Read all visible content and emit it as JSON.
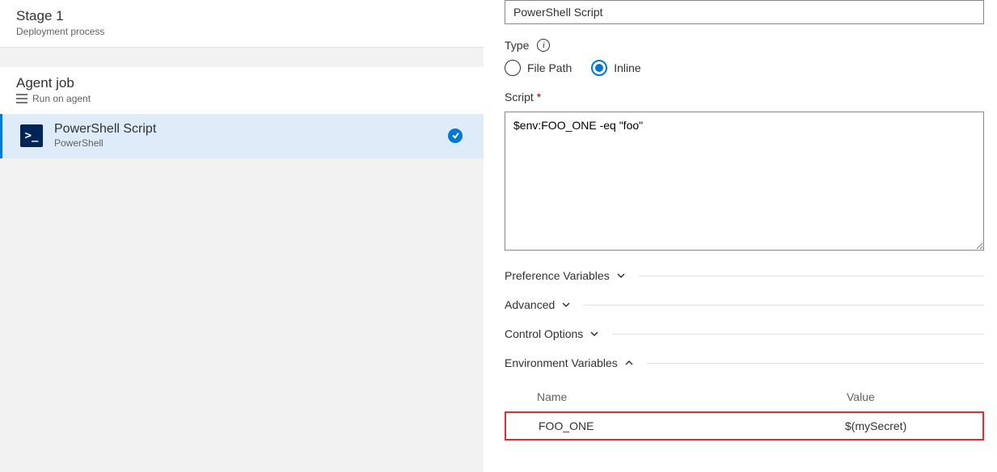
{
  "left": {
    "stage_title": "Stage 1",
    "stage_sub": "Deployment process",
    "job_title": "Agent job",
    "job_sub": "Run on agent",
    "task_title": "PowerShell Script",
    "task_sub": "PowerShell"
  },
  "form": {
    "display_name_value": "PowerShell Script",
    "type_label": "Type",
    "radio_file_path": "File Path",
    "radio_inline": "Inline",
    "script_label": "Script",
    "script_value": "$env:FOO_ONE -eq \"foo\""
  },
  "sections": {
    "pref_vars": "Preference Variables",
    "advanced": "Advanced",
    "control_options": "Control Options",
    "env_vars": "Environment Variables"
  },
  "env_table": {
    "header_name": "Name",
    "header_value": "Value",
    "rows": [
      {
        "name": "FOO_ONE",
        "value": "$(mySecret)"
      }
    ]
  }
}
